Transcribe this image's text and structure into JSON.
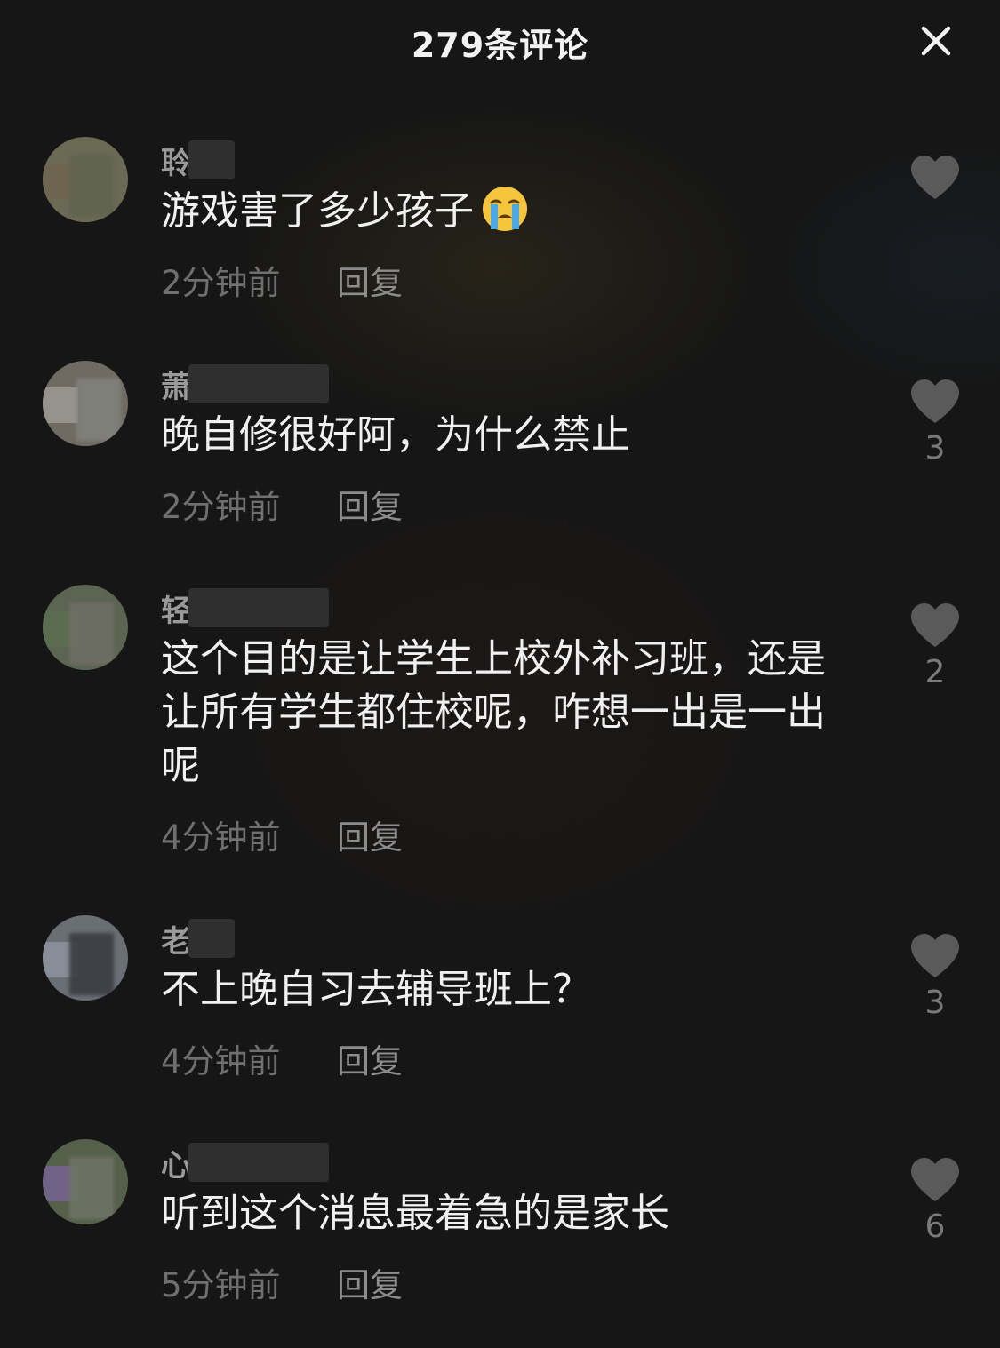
{
  "header": {
    "title": "279条评论",
    "close_icon": "close-icon"
  },
  "comments": [
    {
      "username": "聆",
      "text": "游戏害了多少孩子",
      "emoji": "loudly-crying-face-emoji",
      "time": "2分钟前",
      "reply_label": "回复",
      "likes": ""
    },
    {
      "username": "萧",
      "text": "晚自修很好阿，为什么禁止",
      "time": "2分钟前",
      "reply_label": "回复",
      "likes": "3"
    },
    {
      "username": "轻",
      "text_lines": [
        "这个目的是让学生上校外补习班，还是",
        "让所有学生都住校呢，咋想一出是一出",
        "呢"
      ],
      "time": "4分钟前",
      "reply_label": "回复",
      "likes": "2"
    },
    {
      "username": "老",
      "text": "不上晚自习去辅导班上？",
      "time": "4分钟前",
      "reply_label": "回复",
      "likes": "3"
    },
    {
      "username": "心",
      "text": "听到这个消息最着急的是家长",
      "time": "5分钟前",
      "reply_label": "回复",
      "likes": "6"
    }
  ],
  "colors": {
    "background": "#161616",
    "text_primary": "#f0f0f0",
    "text_secondary": "#6f6f6f",
    "heart": "#5a5a5a"
  }
}
